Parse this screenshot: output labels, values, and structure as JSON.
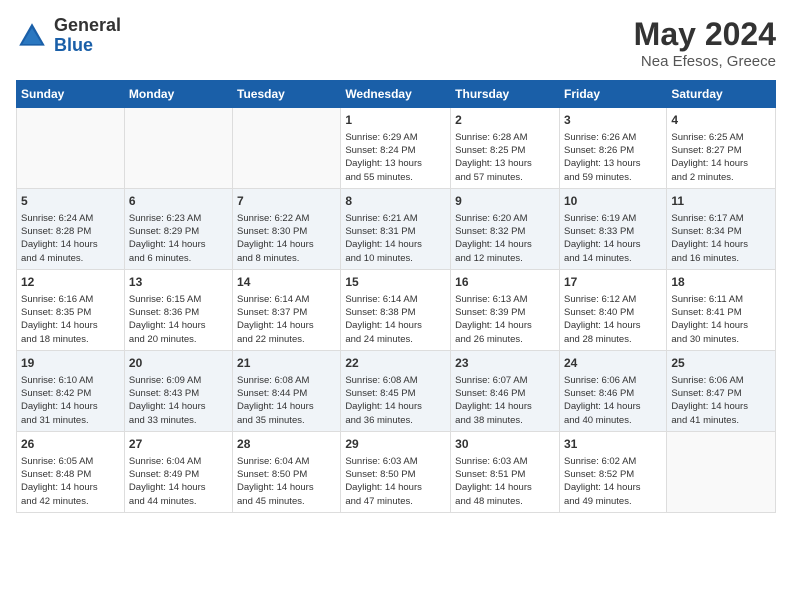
{
  "header": {
    "logo_general": "General",
    "logo_blue": "Blue",
    "month_title": "May 2024",
    "location": "Nea Efesos, Greece"
  },
  "days_of_week": [
    "Sunday",
    "Monday",
    "Tuesday",
    "Wednesday",
    "Thursday",
    "Friday",
    "Saturday"
  ],
  "weeks": [
    [
      {
        "day": "",
        "info": ""
      },
      {
        "day": "",
        "info": ""
      },
      {
        "day": "",
        "info": ""
      },
      {
        "day": "1",
        "info": "Sunrise: 6:29 AM\nSunset: 8:24 PM\nDaylight: 13 hours\nand 55 minutes."
      },
      {
        "day": "2",
        "info": "Sunrise: 6:28 AM\nSunset: 8:25 PM\nDaylight: 13 hours\nand 57 minutes."
      },
      {
        "day": "3",
        "info": "Sunrise: 6:26 AM\nSunset: 8:26 PM\nDaylight: 13 hours\nand 59 minutes."
      },
      {
        "day": "4",
        "info": "Sunrise: 6:25 AM\nSunset: 8:27 PM\nDaylight: 14 hours\nand 2 minutes."
      }
    ],
    [
      {
        "day": "5",
        "info": "Sunrise: 6:24 AM\nSunset: 8:28 PM\nDaylight: 14 hours\nand 4 minutes."
      },
      {
        "day": "6",
        "info": "Sunrise: 6:23 AM\nSunset: 8:29 PM\nDaylight: 14 hours\nand 6 minutes."
      },
      {
        "day": "7",
        "info": "Sunrise: 6:22 AM\nSunset: 8:30 PM\nDaylight: 14 hours\nand 8 minutes."
      },
      {
        "day": "8",
        "info": "Sunrise: 6:21 AM\nSunset: 8:31 PM\nDaylight: 14 hours\nand 10 minutes."
      },
      {
        "day": "9",
        "info": "Sunrise: 6:20 AM\nSunset: 8:32 PM\nDaylight: 14 hours\nand 12 minutes."
      },
      {
        "day": "10",
        "info": "Sunrise: 6:19 AM\nSunset: 8:33 PM\nDaylight: 14 hours\nand 14 minutes."
      },
      {
        "day": "11",
        "info": "Sunrise: 6:17 AM\nSunset: 8:34 PM\nDaylight: 14 hours\nand 16 minutes."
      }
    ],
    [
      {
        "day": "12",
        "info": "Sunrise: 6:16 AM\nSunset: 8:35 PM\nDaylight: 14 hours\nand 18 minutes."
      },
      {
        "day": "13",
        "info": "Sunrise: 6:15 AM\nSunset: 8:36 PM\nDaylight: 14 hours\nand 20 minutes."
      },
      {
        "day": "14",
        "info": "Sunrise: 6:14 AM\nSunset: 8:37 PM\nDaylight: 14 hours\nand 22 minutes."
      },
      {
        "day": "15",
        "info": "Sunrise: 6:14 AM\nSunset: 8:38 PM\nDaylight: 14 hours\nand 24 minutes."
      },
      {
        "day": "16",
        "info": "Sunrise: 6:13 AM\nSunset: 8:39 PM\nDaylight: 14 hours\nand 26 minutes."
      },
      {
        "day": "17",
        "info": "Sunrise: 6:12 AM\nSunset: 8:40 PM\nDaylight: 14 hours\nand 28 minutes."
      },
      {
        "day": "18",
        "info": "Sunrise: 6:11 AM\nSunset: 8:41 PM\nDaylight: 14 hours\nand 30 minutes."
      }
    ],
    [
      {
        "day": "19",
        "info": "Sunrise: 6:10 AM\nSunset: 8:42 PM\nDaylight: 14 hours\nand 31 minutes."
      },
      {
        "day": "20",
        "info": "Sunrise: 6:09 AM\nSunset: 8:43 PM\nDaylight: 14 hours\nand 33 minutes."
      },
      {
        "day": "21",
        "info": "Sunrise: 6:08 AM\nSunset: 8:44 PM\nDaylight: 14 hours\nand 35 minutes."
      },
      {
        "day": "22",
        "info": "Sunrise: 6:08 AM\nSunset: 8:45 PM\nDaylight: 14 hours\nand 36 minutes."
      },
      {
        "day": "23",
        "info": "Sunrise: 6:07 AM\nSunset: 8:46 PM\nDaylight: 14 hours\nand 38 minutes."
      },
      {
        "day": "24",
        "info": "Sunrise: 6:06 AM\nSunset: 8:46 PM\nDaylight: 14 hours\nand 40 minutes."
      },
      {
        "day": "25",
        "info": "Sunrise: 6:06 AM\nSunset: 8:47 PM\nDaylight: 14 hours\nand 41 minutes."
      }
    ],
    [
      {
        "day": "26",
        "info": "Sunrise: 6:05 AM\nSunset: 8:48 PM\nDaylight: 14 hours\nand 42 minutes."
      },
      {
        "day": "27",
        "info": "Sunrise: 6:04 AM\nSunset: 8:49 PM\nDaylight: 14 hours\nand 44 minutes."
      },
      {
        "day": "28",
        "info": "Sunrise: 6:04 AM\nSunset: 8:50 PM\nDaylight: 14 hours\nand 45 minutes."
      },
      {
        "day": "29",
        "info": "Sunrise: 6:03 AM\nSunset: 8:50 PM\nDaylight: 14 hours\nand 47 minutes."
      },
      {
        "day": "30",
        "info": "Sunrise: 6:03 AM\nSunset: 8:51 PM\nDaylight: 14 hours\nand 48 minutes."
      },
      {
        "day": "31",
        "info": "Sunrise: 6:02 AM\nSunset: 8:52 PM\nDaylight: 14 hours\nand 49 minutes."
      },
      {
        "day": "",
        "info": ""
      }
    ]
  ]
}
